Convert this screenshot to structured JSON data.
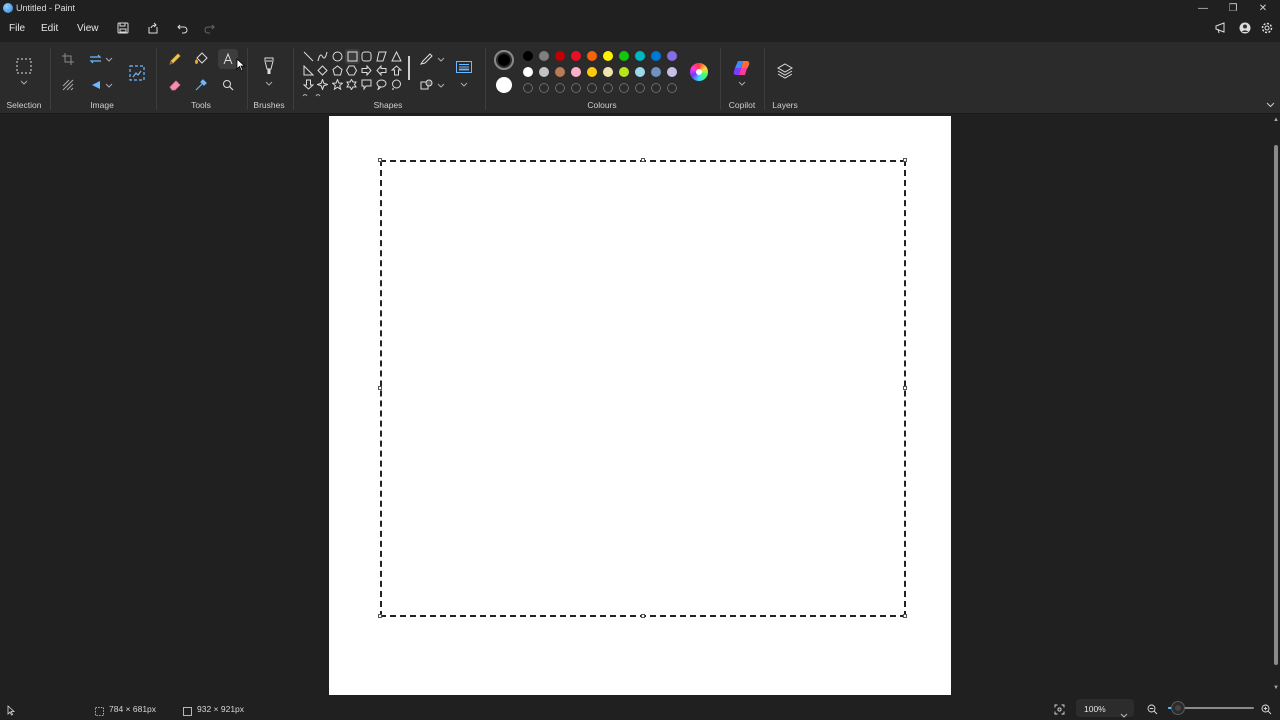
{
  "window": {
    "title": "Untitled - Paint",
    "minimize_glyph": "—",
    "restore_glyph": "❐",
    "close_glyph": "✕"
  },
  "menu": {
    "file": "File",
    "edit": "Edit",
    "view": "View"
  },
  "ribbon": {
    "groups": {
      "selection": "Selection",
      "image": "Image",
      "tools": "Tools",
      "brushes": "Brushes",
      "shapes": "Shapes",
      "colours": "Colours",
      "copilot": "Copilot",
      "layers": "Layers"
    },
    "active_tool": "text-tool",
    "colours": {
      "primary": "#000000",
      "secondary": "#ffffff",
      "row1": [
        "#000000",
        "#7f7f7f",
        "#c00000",
        "#e81123",
        "#f7630c",
        "#fff100",
        "#16c60c",
        "#00b7c3",
        "#0078d7",
        "#886ce4"
      ],
      "row2": [
        "#ffffff",
        "#c3c3c3",
        "#b97a57",
        "#ffaec9",
        "#ffc90e",
        "#efe4b0",
        "#b5e61d",
        "#99d9ea",
        "#7092be",
        "#c8bfe7"
      ],
      "custom_slots": 10
    }
  },
  "status": {
    "selection_size": "784 × 681px",
    "canvas_size": "932 × 921px",
    "zoom": "100%",
    "zoom_level": 0.12
  }
}
